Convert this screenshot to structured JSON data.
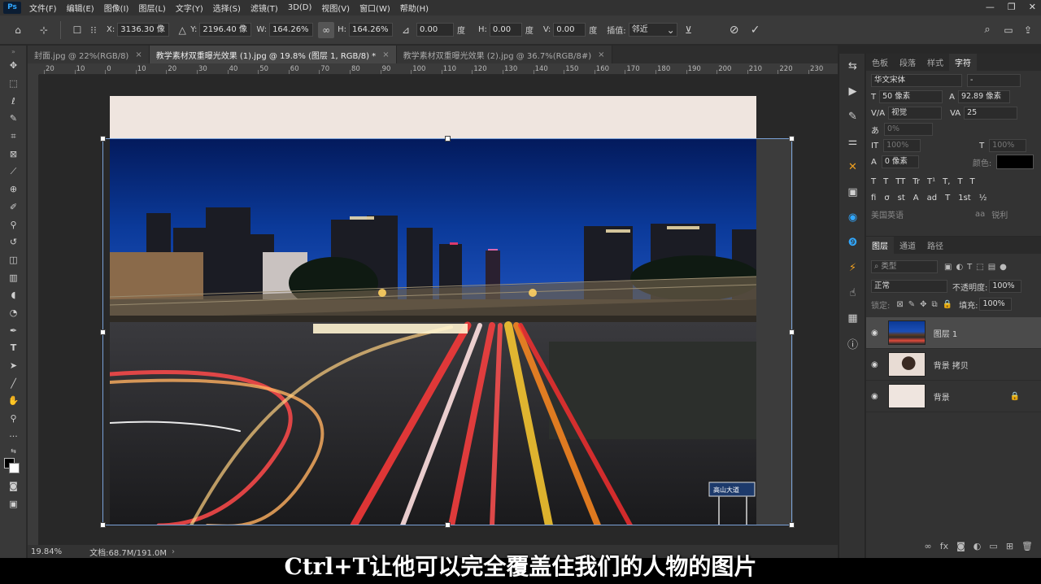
{
  "app": {
    "logo": "Ps"
  },
  "menu": [
    "文件(F)",
    "编辑(E)",
    "图像(I)",
    "图层(L)",
    "文字(Y)",
    "选择(S)",
    "滤镜(T)",
    "3D(D)",
    "视图(V)",
    "窗口(W)",
    "帮助(H)"
  ],
  "window_controls": {
    "minimize": "—",
    "restore": "❐",
    "close": "✕"
  },
  "options": {
    "x_label": "X:",
    "x_value": "3136.30 像",
    "y_label": "Y:",
    "y_value": "2196.40 像",
    "w_label": "W:",
    "w_value": "164.26%",
    "h_label": "H:",
    "h_value": "164.26%",
    "angle_value": "0.00",
    "angle_unit": "度",
    "hskew_label": "H:",
    "hskew_value": "0.00",
    "hskew_unit": "度",
    "vskew_label": "V:",
    "vskew_value": "0.00",
    "vskew_unit": "度",
    "interp_label": "插值:",
    "interp_value": "邻近"
  },
  "tabs": [
    {
      "label": "封面.jpg @ 22%(RGB/8)"
    },
    {
      "label": "教学素材双重曝光效果 (1).jpg @ 19.8% (图层 1, RGB/8) *"
    },
    {
      "label": "教学素材双重曝光效果 (2).jpg @ 36.7%(RGB/8#)"
    }
  ],
  "ruler_ticks": [
    "20",
    "10",
    "0",
    "10",
    "20",
    "30",
    "40",
    "50",
    "60",
    "70",
    "80",
    "90",
    "100",
    "110",
    "120",
    "130",
    "140",
    "150",
    "160",
    "170",
    "180",
    "190",
    "200",
    "210",
    "220",
    "230"
  ],
  "status": {
    "zoom": "19.84%",
    "doc": "文档:68.7M/191.0M"
  },
  "char_panel": {
    "tabs": [
      "色板",
      "段落",
      "样式",
      "字符"
    ],
    "font_family": "华文宋体",
    "font_style": "-",
    "size": "50 像素",
    "leading": "92.89 像素",
    "kerning": "视觉",
    "tracking": "25",
    "scale_pct": "0%",
    "vscale": "100%",
    "hscale": "100%",
    "baseline": "0 像素",
    "color_label": "颜色:",
    "lang": "美国英语",
    "aa": "锐利",
    "text_style_buttons": [
      "T",
      "T",
      "TT",
      "Tr",
      "T¹",
      "T,",
      "T",
      "T"
    ],
    "opentype_buttons": [
      "fi",
      "σ",
      "st",
      "A",
      "ad",
      "T",
      "1st",
      "½"
    ]
  },
  "layers_panel": {
    "tabs": [
      "图层",
      "通道",
      "路径"
    ],
    "filter_kind": "类型",
    "blend_mode": "正常",
    "opacity_label": "不透明度:",
    "opacity_value": "100%",
    "lock_label": "锁定:",
    "fill_label": "填充:",
    "fill_value": "100%",
    "layers": [
      {
        "name": "图层 1",
        "selected": true
      },
      {
        "name": "背景 拷贝",
        "selected": false
      },
      {
        "name": "背景",
        "selected": false,
        "locked": true
      }
    ]
  },
  "subtitle": "Ctrl+T让他可以完全覆盖住我们的人物的图片",
  "road_sign": "高山大道",
  "colors": {
    "accent": "#31a8ff",
    "handle_border": "#7aa2d8",
    "doc_bg": "#efe5df"
  }
}
